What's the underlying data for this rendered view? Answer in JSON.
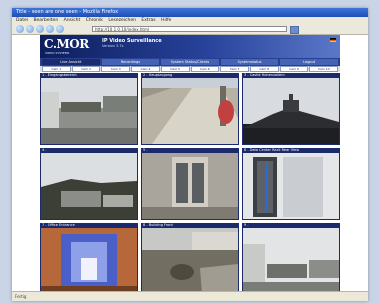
{
  "browser": {
    "title": "Title - seen are one seen - Mozilla Firefox",
    "menu": [
      "Datei",
      "Bearbeiten",
      "Ansicht",
      "Chronik",
      "Lesezeichen",
      "Extras",
      "Hilfe"
    ],
    "url": "http://10.1.0.10/index.html",
    "status": "Fertig"
  },
  "app": {
    "logo": "C.MOR",
    "logo_sub": "VIDEO SYSTEMS",
    "title": "IP Video Surveillance",
    "subtitle": "Version 3.7x",
    "nav_tabs": [
      "Live Ansicht",
      "Recordings",
      "System Status/Clients",
      "Systemstatus",
      "Logout"
    ],
    "cam_tabs": [
      "Cam 1",
      "Cam 2",
      "Cam 3",
      "Cam 4",
      "Cam 5",
      "Cam 6",
      "Cam 7",
      "Cam 8",
      "Cam 9",
      "Cam 10"
    ]
  },
  "cameras": [
    {
      "label": "1 - Eingangsbereich"
    },
    {
      "label": "2 - Hauptzugang"
    },
    {
      "label": "3 - Castle Hohenzollern"
    },
    {
      "label": "4 -"
    },
    {
      "label": "5 -"
    },
    {
      "label": "6 - Data Center Rack Rear View"
    },
    {
      "label": "7 - Office Entrance"
    },
    {
      "label": "8 - Building Front"
    },
    {
      "label": "9 -"
    }
  ],
  "colors": {
    "accent": "#1b2a6a",
    "header_start": "#0d1e5c",
    "header_end": "#5a78c8"
  }
}
